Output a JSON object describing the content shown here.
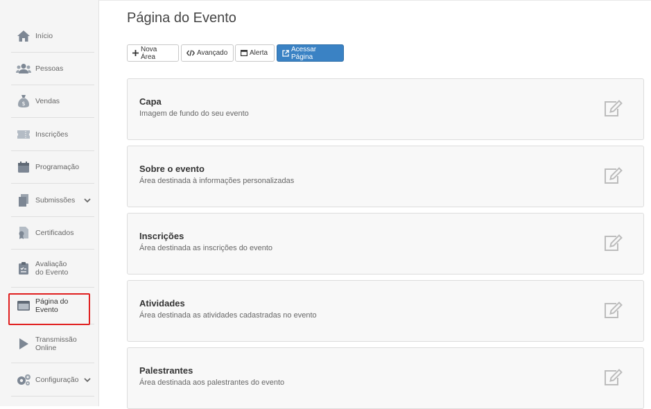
{
  "sidebar": {
    "items": [
      {
        "label": "Início",
        "icon": "home-icon"
      },
      {
        "label": "Pessoas",
        "icon": "users-icon"
      },
      {
        "label": "Vendas",
        "icon": "money-bag-icon"
      },
      {
        "label": "Inscrições",
        "icon": "ticket-icon"
      },
      {
        "label": "Programação",
        "icon": "calendar-icon"
      },
      {
        "label": "Submissões",
        "icon": "documents-icon"
      },
      {
        "label": "Certificados",
        "icon": "certificate-icon"
      },
      {
        "label_line1": "Avaliação",
        "label_line2": "do Evento",
        "icon": "clipboard-icon"
      },
      {
        "label_line1": "Página do",
        "label_line2": "Evento",
        "icon": "browser-window-icon",
        "active": true
      },
      {
        "label_line1": "Transmissão",
        "label_line2": "Online",
        "icon": "play-icon"
      },
      {
        "label": "Configuração",
        "icon": "gears-icon"
      }
    ]
  },
  "main": {
    "title": "Página do Evento",
    "toolbar": {
      "nova_area": "Nova Área",
      "avancado": "Avançado",
      "alerta": "Alerta",
      "acessar": "Acessar Página"
    },
    "cards": [
      {
        "title": "Capa",
        "desc": "Imagem de fundo do seu evento"
      },
      {
        "title": "Sobre o evento",
        "desc": "Área destinada à informações personalizadas"
      },
      {
        "title": "Inscrições",
        "desc": "Área destinada as inscrições do evento"
      },
      {
        "title": "Atividades",
        "desc": "Área destinada as atividades cadastradas no evento"
      },
      {
        "title": "Palestrantes",
        "desc": "Área destinada aos palestrantes do evento"
      }
    ]
  },
  "colors": {
    "primary": "#3a82c4",
    "highlight": "#e01e1e",
    "icon_gray": "#7d8794"
  }
}
